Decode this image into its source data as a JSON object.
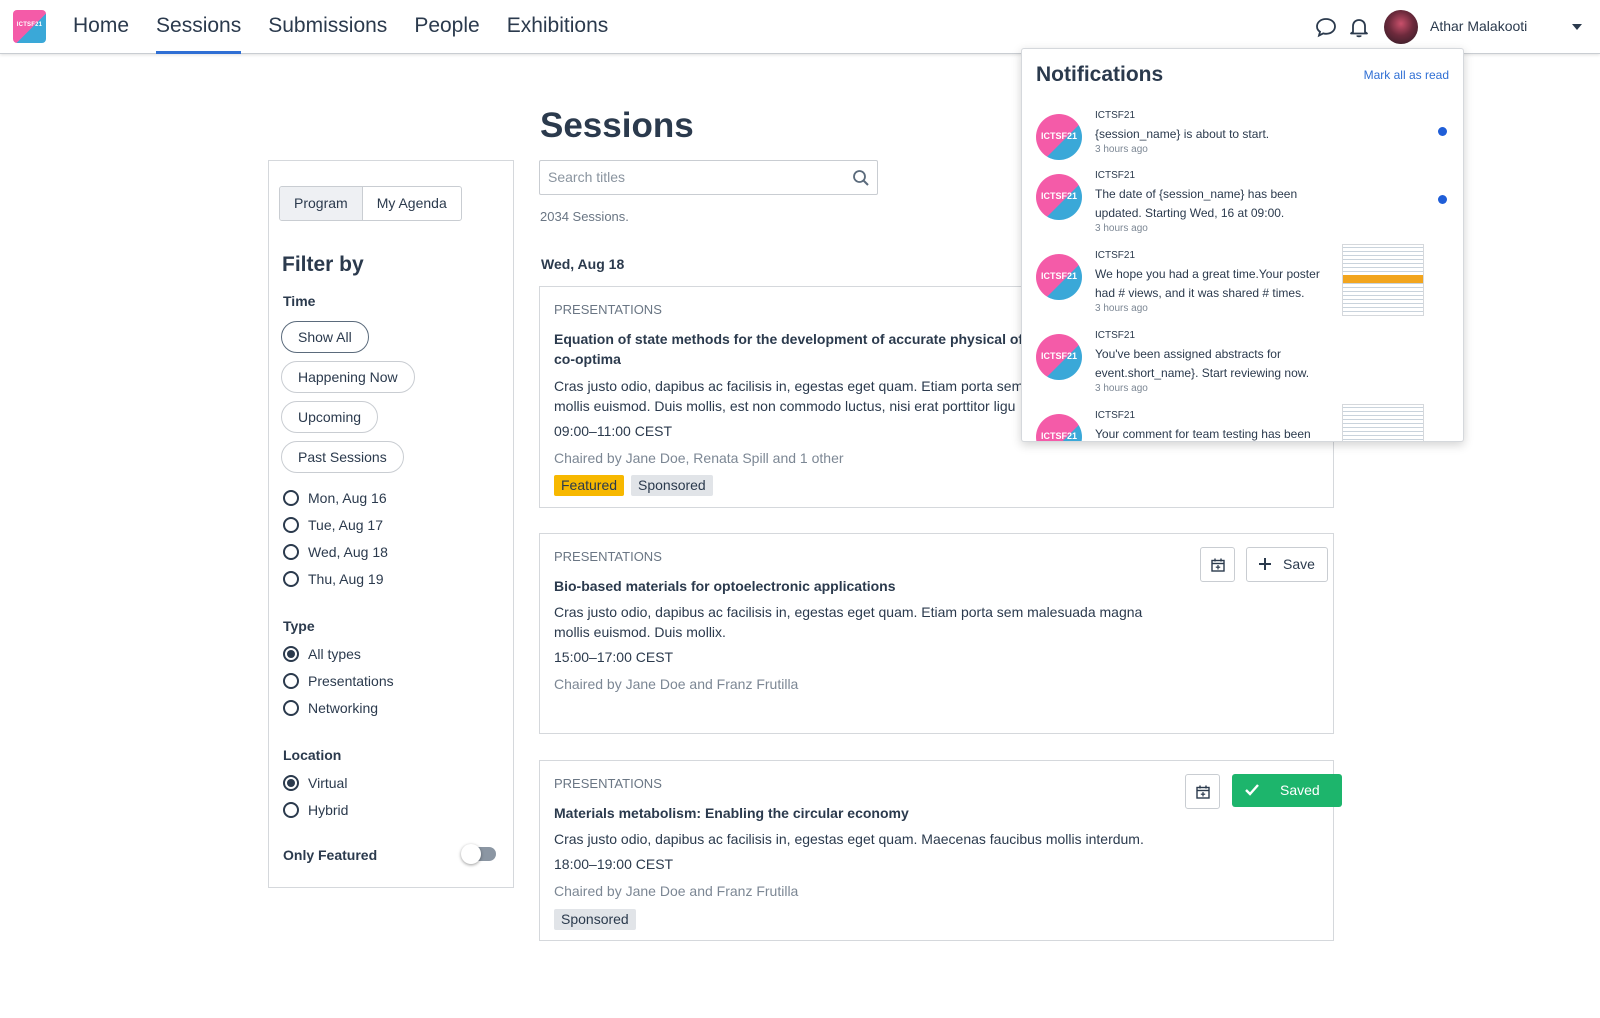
{
  "logo": {
    "text": "ICTSF21"
  },
  "nav": {
    "items": [
      {
        "label": "Home",
        "active": false
      },
      {
        "label": "Sessions",
        "active": true
      },
      {
        "label": "Submissions",
        "active": false
      },
      {
        "label": "People",
        "active": false
      },
      {
        "label": "Exhibitions",
        "active": false
      }
    ]
  },
  "user": {
    "name": "Athar Malakooti"
  },
  "page": {
    "title": "Sessions"
  },
  "sidebar": {
    "tabs": [
      "Program",
      "My Agenda"
    ],
    "filter_title": "Filter by",
    "time": {
      "label": "Time",
      "pills": [
        "Show All",
        "Happening Now",
        "Upcoming",
        "Past Sessions"
      ],
      "days": [
        "Mon, Aug 16",
        "Tue, Aug 17",
        "Wed, Aug 18",
        "Thu, Aug 19"
      ]
    },
    "type": {
      "label": "Type",
      "options": [
        "All types",
        "Presentations",
        "Networking"
      ],
      "selected": "All types"
    },
    "location": {
      "label": "Location",
      "options": [
        "Virtual",
        "Hybrid"
      ],
      "selected": "Virtual"
    },
    "only_featured": {
      "label": "Only Featured",
      "on": false
    }
  },
  "search": {
    "placeholder": "Search titles",
    "value": ""
  },
  "results": {
    "count_text": "2034 Sessions."
  },
  "day_heading": "Wed, Aug 18",
  "sessions": [
    {
      "kind": "Presentations",
      "title": "Equation of state methods for the development of accurate physical of co-optima",
      "description": "Cras justo odio, dapibus ac facilisis in, egestas eget quam. Etiam porta sem mollis euismod. Duis mollis, est non commodo luctus, nisi erat porttitor ligu",
      "time": "09:00–11:00 CEST",
      "chairs": "Chaired by Jane Doe, Renata Spill and 1 other",
      "tags": [
        "Featured",
        "Sponsored"
      ]
    },
    {
      "kind": "Presentations",
      "title": "Bio-based materials for optoelectronic applications",
      "description": "Cras justo odio, dapibus ac facilisis in, egestas eget quam. Etiam porta sem malesuada magna mollis euismod. Duis mollix.",
      "time": "15:00–17:00 CEST",
      "chairs": "Chaired by Jane Doe and Franz Frutilla",
      "tags": [],
      "save_label": "Save"
    },
    {
      "kind": "Presentations",
      "title": "Materials metabolism: Enabling the circular economy",
      "description": "Cras justo odio, dapibus ac facilisis in, egestas eget quam. Maecenas faucibus mollis interdum.",
      "time": "18:00–19:00 CEST",
      "chairs": "Chaired by Jane Doe and Franz Frutilla",
      "tags": [
        "Sponsored"
      ],
      "saved_label": "Saved"
    }
  ],
  "notifications": {
    "title": "Notifications",
    "mark_all": "Mark all as read",
    "items": [
      {
        "source": "ICTSF21",
        "text": "{session_name} is about to start.",
        "time": "3 hours ago",
        "unread": true,
        "thumbnail": false
      },
      {
        "source": "ICTSF21",
        "text": "The date of {session_name} has been updated. Starting Wed, 16 at 09:00.",
        "time": "3 hours ago",
        "unread": true,
        "thumbnail": false
      },
      {
        "source": "ICTSF21",
        "text": "We hope you had a great time.Your poster had # views, and it was shared # times.",
        "time": "3 hours ago",
        "unread": false,
        "thumbnail": true
      },
      {
        "source": "ICTSF21",
        "text": "You've been assigned abstracts for event.short_name}. Start reviewing now.",
        "time": "3 hours ago",
        "unread": false,
        "thumbnail": false
      },
      {
        "source": "ICTSF21",
        "text": "Your comment for team testing has been",
        "time": "",
        "unread": false,
        "thumbnail": true
      }
    ]
  },
  "colors": {
    "accent": "#2f6fd4",
    "featured": "#f7b800",
    "saved": "#1db56c",
    "unread_dot": "#1f5ed8"
  }
}
